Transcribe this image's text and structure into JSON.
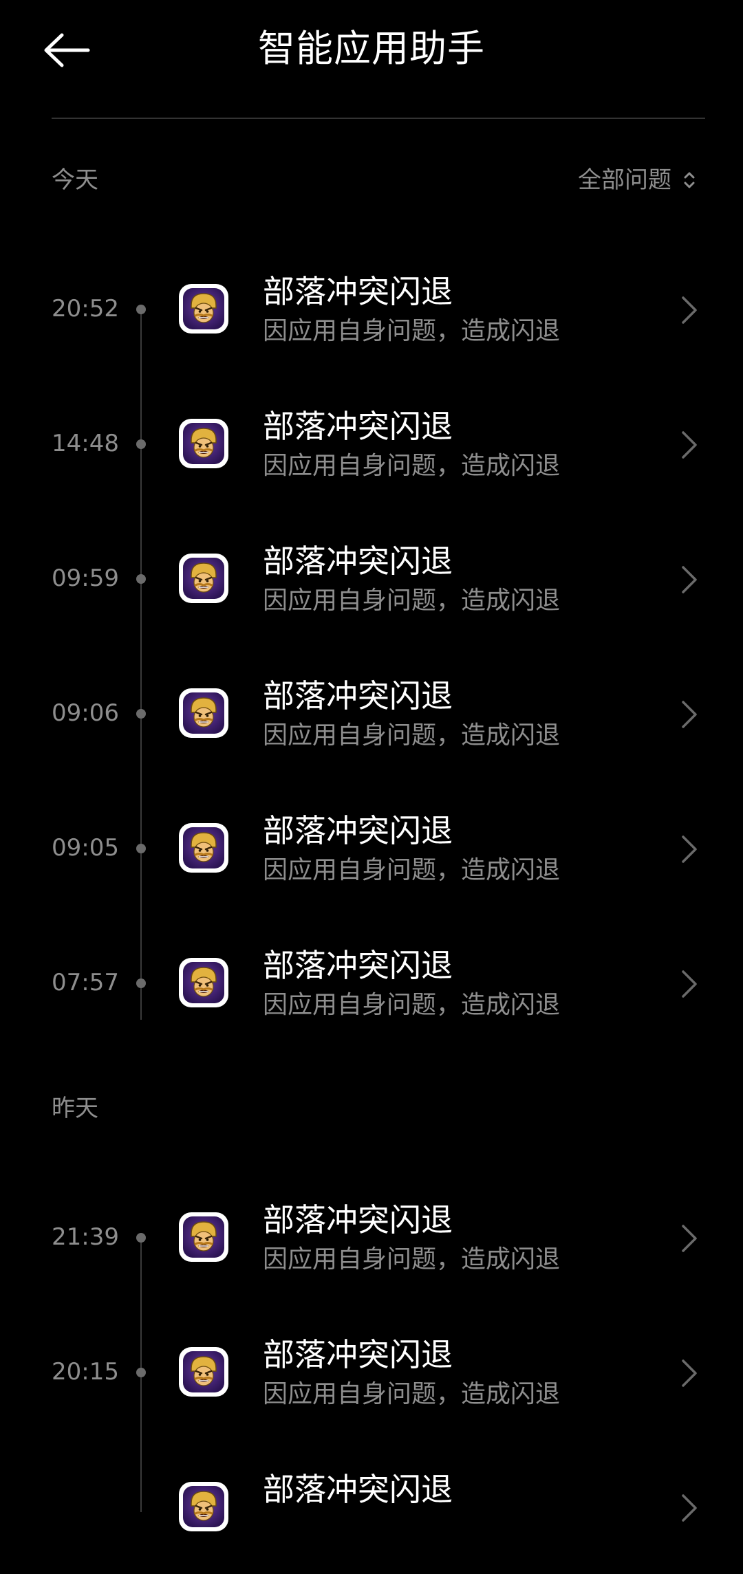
{
  "header": {
    "title": "智能应用助手",
    "back_icon": "arrow-left-icon"
  },
  "filter": {
    "label": "全部问题",
    "icon": "chevron-up-down-icon"
  },
  "sections": [
    {
      "label": "今天",
      "items": [
        {
          "time": "20:52",
          "title": "部落冲突闪退",
          "subtitle": "因应用自身问题，造成闪退"
        },
        {
          "time": "14:48",
          "title": "部落冲突闪退",
          "subtitle": "因应用自身问题，造成闪退"
        },
        {
          "time": "09:59",
          "title": "部落冲突闪退",
          "subtitle": "因应用自身问题，造成闪退"
        },
        {
          "time": "09:06",
          "title": "部落冲突闪退",
          "subtitle": "因应用自身问题，造成闪退"
        },
        {
          "time": "09:05",
          "title": "部落冲突闪退",
          "subtitle": "因应用自身问题，造成闪退"
        },
        {
          "time": "07:57",
          "title": "部落冲突闪退",
          "subtitle": "因应用自身问题，造成闪退"
        }
      ]
    },
    {
      "label": "昨天",
      "items": [
        {
          "time": "21:39",
          "title": "部落冲突闪退",
          "subtitle": "因应用自身问题，造成闪退"
        },
        {
          "time": "20:15",
          "title": "部落冲突闪退",
          "subtitle": "因应用自身问题，造成闪退"
        },
        {
          "time": "",
          "title": "部落冲突闪退",
          "subtitle": ""
        }
      ]
    }
  ],
  "colors": {
    "background": "#000000",
    "text_primary": "#ffffff",
    "text_secondary": "#8e8e8e",
    "divider": "#333333",
    "timeline": "#3a3a3a",
    "icon_bg": "#ffffff"
  },
  "app_icon": "clash-of-clans-app-icon"
}
